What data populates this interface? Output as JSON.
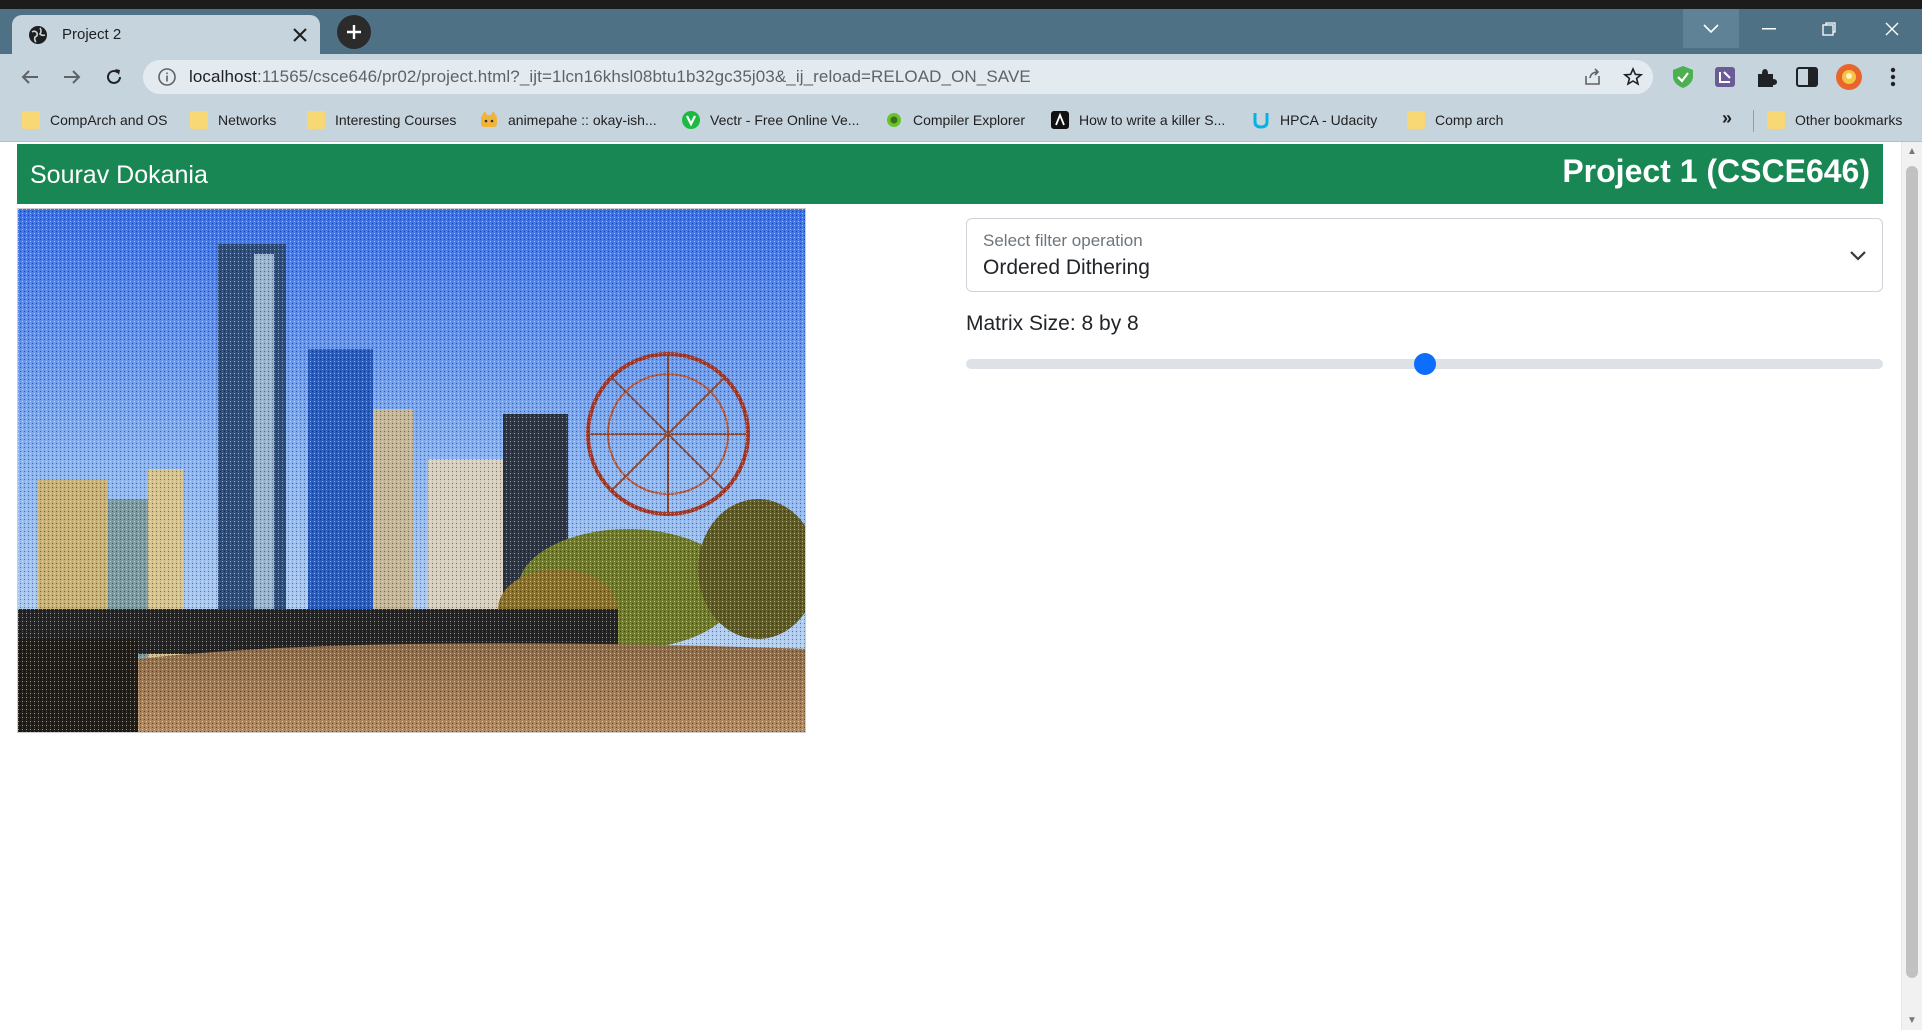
{
  "browser": {
    "tab_title": "Project 2",
    "url_host": "localhost",
    "url_path": ":11565/csce646/pr02/project.html?_ijt=1lcn16khsl08btu1b32gc35j03&_ij_reload=RELOAD_ON_SAVE",
    "bookmarks": [
      {
        "label": "CompArch and OS",
        "icon": "folder-icon"
      },
      {
        "label": "Networks",
        "icon": "folder-icon"
      },
      {
        "label": "Interesting Courses",
        "icon": "folder-icon"
      },
      {
        "label": "animepahe :: okay-ish...",
        "icon": "animepahe-icon"
      },
      {
        "label": "Vectr - Free Online Ve...",
        "icon": "vectr-icon"
      },
      {
        "label": "Compiler Explorer",
        "icon": "compiler-explorer-icon"
      },
      {
        "label": "How to write a killer S...",
        "icon": "site-icon"
      },
      {
        "label": "HPCA - Udacity",
        "icon": "udacity-icon"
      },
      {
        "label": "Comp arch",
        "icon": "folder-icon"
      }
    ],
    "more_bookmarks": "»",
    "other_bookmarks": "Other bookmarks"
  },
  "page": {
    "header_name": "Sourav Dokania",
    "header_project": "Project 1 (CSCE646)",
    "filter_label": "Select filter operation",
    "filter_value": "Ordered Dithering",
    "matrix_label": "Matrix Size: 8 by 8",
    "slider_fraction": 0.5,
    "image_description_icon": "dithered-skyline-image"
  },
  "colors": {
    "header_bg": "#198754",
    "slider_thumb": "#0d6efd",
    "tab_bar": "#4f7186",
    "toolbar": "#c6d4de"
  }
}
